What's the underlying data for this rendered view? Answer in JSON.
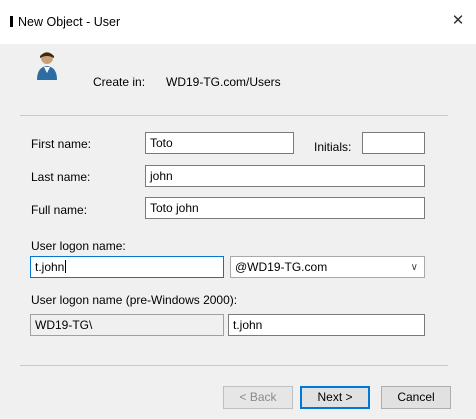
{
  "window": {
    "title": "New Object - User",
    "close_glyph": "✕"
  },
  "header": {
    "create_in_label": "Create in:",
    "create_in_path": "WD19-TG.com/Users",
    "icon": "user-icon"
  },
  "form": {
    "first_name_label": "First name:",
    "first_name_value": "Toto",
    "initials_label": "Initials:",
    "initials_value": "",
    "last_name_label": "Last name:",
    "last_name_value": "john",
    "full_name_label": "Full name:",
    "full_name_value": "Toto john",
    "logon_name_label": "User logon name:",
    "logon_name_value": "t.john",
    "domain_suffix": "@WD19-TG.com",
    "pre2000_label": "User logon name (pre-Windows 2000):",
    "pre2000_domain": "WD19-TG\\",
    "pre2000_value": "t.john"
  },
  "buttons": {
    "back": "< Back",
    "next": "Next >",
    "cancel": "Cancel"
  },
  "colors": {
    "focus_border": "#0078d7",
    "dialog_bg": "#f0f0f0"
  }
}
